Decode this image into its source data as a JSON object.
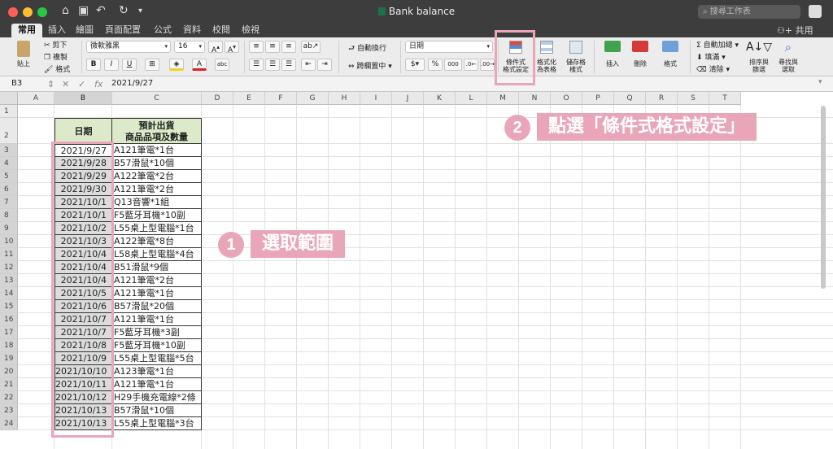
{
  "window": {
    "title": "Bank balance",
    "search_placeholder": "搜尋工作表"
  },
  "tabs": [
    "常用",
    "插入",
    "繪圖",
    "頁面配置",
    "公式",
    "資料",
    "校閱",
    "檢視"
  ],
  "share_label": "共用",
  "ribbon": {
    "paste": "貼上",
    "cut": "剪下",
    "copy": "複製",
    "format_painter": "格式",
    "font_name": "微軟雅黑",
    "font_size": "16",
    "bold": "B",
    "italic": "I",
    "underline": "U",
    "wrap": "自動換行",
    "merge": "跨欄置中",
    "number_format": "日期",
    "percent": "%",
    "comma": "000",
    "conditional_format_line1": "條件式",
    "conditional_format_line2": "格式設定",
    "format_as_table_line1": "格式化",
    "format_as_table_line2": "為表格",
    "cell_styles_line1": "儲存格",
    "cell_styles_line2": "樣式",
    "insert": "插入",
    "delete": "刪除",
    "format": "格式",
    "autosum": "自動加總",
    "fill": "填滿",
    "clear": "清除",
    "sort_line1": "排序與",
    "sort_line2": "篩選",
    "find_line1": "尋找與",
    "find_line2": "選取"
  },
  "formula_bar": {
    "name_box": "B3",
    "fx": "fx",
    "value": "2021/9/27"
  },
  "columns": [
    "A",
    "B",
    "C",
    "D",
    "E",
    "F",
    "G",
    "H",
    "I",
    "J",
    "K",
    "L",
    "M",
    "N",
    "O",
    "P",
    "Q",
    "R",
    "S",
    "T"
  ],
  "rows": [
    "1",
    "2",
    "3",
    "4",
    "5",
    "6",
    "7",
    "8",
    "9",
    "10",
    "11",
    "12",
    "13",
    "14",
    "15",
    "16",
    "17",
    "18",
    "19",
    "20",
    "21",
    "22",
    "23",
    "24"
  ],
  "table": {
    "header_date": "日期",
    "header_item_line1": "預計出貨",
    "header_item_line2": "商品品項及數量",
    "rows": [
      {
        "date": "2021/9/27",
        "item": "A121筆電*1台"
      },
      {
        "date": "2021/9/28",
        "item": "B57滑鼠*10個"
      },
      {
        "date": "2021/9/29",
        "item": "A122筆電*2台"
      },
      {
        "date": "2021/9/30",
        "item": "A121筆電*2台"
      },
      {
        "date": "2021/10/1",
        "item": "Q13音響*1組"
      },
      {
        "date": "2021/10/1",
        "item": "F5藍牙耳機*10副"
      },
      {
        "date": "2021/10/2",
        "item": "L55桌上型電腦*1台"
      },
      {
        "date": "2021/10/3",
        "item": "A122筆電*8台"
      },
      {
        "date": "2021/10/4",
        "item": "L58桌上型電腦*4台"
      },
      {
        "date": "2021/10/4",
        "item": "B51滑鼠*9個"
      },
      {
        "date": "2021/10/4",
        "item": "A121筆電*2台"
      },
      {
        "date": "2021/10/5",
        "item": "A121筆電*1台"
      },
      {
        "date": "2021/10/6",
        "item": "B57滑鼠*20個"
      },
      {
        "date": "2021/10/7",
        "item": "A121筆電*1台"
      },
      {
        "date": "2021/10/7",
        "item": "F5藍牙耳機*3副"
      },
      {
        "date": "2021/10/8",
        "item": "F5藍牙耳機*10副"
      },
      {
        "date": "2021/10/9",
        "item": "L55桌上型電腦*5台"
      },
      {
        "date": "2021/10/10",
        "item": "A123筆電*1台"
      },
      {
        "date": "2021/10/11",
        "item": "A121筆電*1台"
      },
      {
        "date": "2021/10/12",
        "item": "H29手機充電線*2條"
      },
      {
        "date": "2021/10/13",
        "item": "B57滑鼠*10個"
      },
      {
        "date": "2021/10/13",
        "item": "L55桌上型電腦*3台"
      }
    ]
  },
  "annotations": {
    "step1_number": "1",
    "step1_text": "選取範圍",
    "step2_number": "2",
    "step2_text": "點選「條件式格式設定」",
    "color": "#e9a6b8"
  }
}
